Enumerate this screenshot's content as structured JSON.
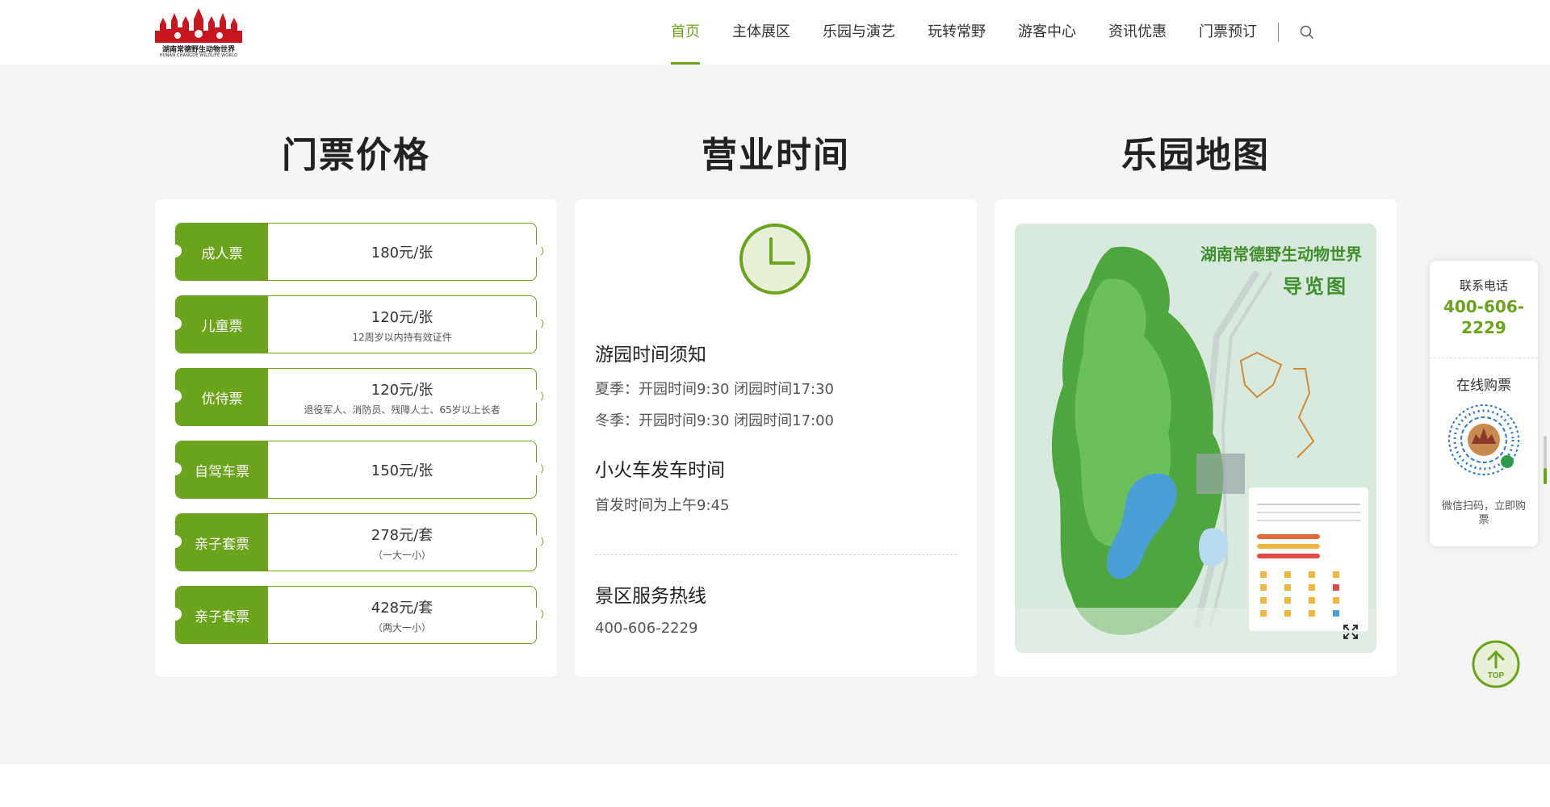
{
  "header": {
    "logo_text": "湖南常德野生动物世界",
    "logo_sub": "HUNAN CHANGDE WILDLIFE WORLD",
    "nav": [
      {
        "label": "首页",
        "active": true
      },
      {
        "label": "主体展区"
      },
      {
        "label": "乐园与演艺"
      },
      {
        "label": "玩转常野"
      },
      {
        "label": "游客中心"
      },
      {
        "label": "资讯优惠"
      },
      {
        "label": "门票预订"
      }
    ],
    "search_icon": "search-icon"
  },
  "sections": {
    "tickets_title": "门票价格",
    "hours_title": "营业时间",
    "map_title": "乐园地图"
  },
  "tickets": [
    {
      "name": "成人票",
      "price": "180元/张",
      "note": ""
    },
    {
      "name": "儿童票",
      "price": "120元/张",
      "note": "12周岁以内持有效证件"
    },
    {
      "name": "优待票",
      "price": "120元/张",
      "note": "退役军人、消防员、残障人士、65岁以上长者"
    },
    {
      "name": "自驾车票",
      "price": "150元/张",
      "note": ""
    },
    {
      "name": "亲子套票",
      "price": "278元/套",
      "note": "（一大一小）"
    },
    {
      "name": "亲子套票",
      "price": "428元/套",
      "note": "（两大一小）"
    }
  ],
  "hours": {
    "visit_title": "游园时间须知",
    "summer": "夏季：开园时间9:30 闭园时间17:30",
    "winter": "冬季：开园时间9:30 闭园时间17:00",
    "train_title": "小火车发车时间",
    "train_time": "首发时间为上午9:45",
    "hotline_title": "景区服务热线",
    "hotline": "400-606-2229"
  },
  "map": {
    "title_line1": "湖南常德野生动物世界",
    "title_line2": "导览图"
  },
  "side": {
    "contact_label": "联系电话",
    "contact_phone": "400-606-2229",
    "buy_label": "在线购票",
    "qr_caption": "微信扫码，立即购票"
  },
  "top_button": {
    "label": "TOP"
  },
  "colors": {
    "accent": "#6ba31c",
    "background": "#f5f5f5"
  }
}
